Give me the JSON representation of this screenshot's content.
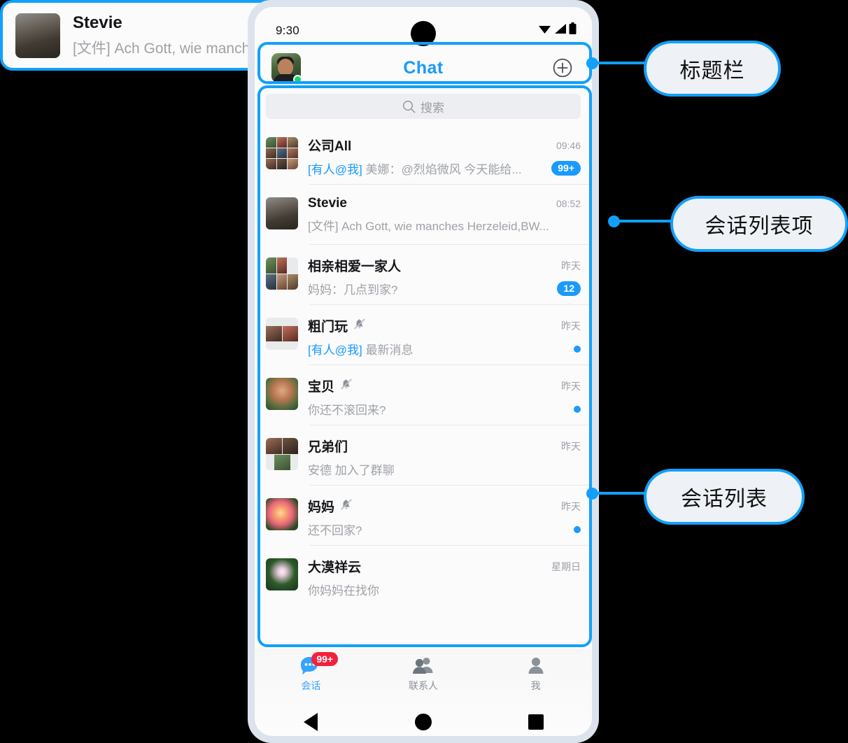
{
  "status_bar": {
    "time": "9:30",
    "wifi_icon": "wifi-icon",
    "signal_icon": "signal-icon",
    "battery_icon": "battery-icon"
  },
  "title_bar": {
    "title": "Chat",
    "add_label": "+",
    "avatar_name": "user-avatar",
    "online": true
  },
  "search": {
    "placeholder": "搜索",
    "icon": "search-icon"
  },
  "conversations": [
    {
      "name": "公司All",
      "time": "09:46",
      "mention": "[有人@我]",
      "message": "美娜：@烈焰微风 今天能给...",
      "badge": "99+",
      "muted": false,
      "avatar": "group-9-grid"
    },
    {
      "name": "Stevie",
      "time": "08:52",
      "mention": "",
      "message": "[文件] Ach Gott, wie manches Herzeleid,BW...",
      "badge": "",
      "muted": false,
      "avatar": "photo-portrait"
    },
    {
      "name": "相亲相爱一家人",
      "time": "昨天",
      "mention": "",
      "message": "妈妈：几点到家?",
      "badge": "12",
      "muted": false,
      "avatar": "group-5-grid"
    },
    {
      "name": "粗门玩",
      "time": "昨天",
      "mention": "[有人@我]",
      "message": "最新消息",
      "badge": "dot",
      "muted": true,
      "avatar": "group-2-grid"
    },
    {
      "name": "宝贝",
      "time": "昨天",
      "mention": "",
      "message": "你还不滚回来?",
      "badge": "dot",
      "muted": true,
      "avatar": "photo-woman"
    },
    {
      "name": "兄弟们",
      "time": "昨天",
      "mention": "",
      "message": "安德 加入了群聊",
      "badge": "",
      "muted": false,
      "avatar": "group-3-grid"
    },
    {
      "name": "妈妈",
      "time": "昨天",
      "mention": "",
      "message": "还不回家?",
      "badge": "dot",
      "muted": true,
      "avatar": "photo-rose"
    },
    {
      "name": "大漠祥云",
      "time": "星期日",
      "mention": "",
      "message": "你妈妈在找你",
      "badge": "",
      "muted": false,
      "avatar": "photo-lotus"
    }
  ],
  "tabs": [
    {
      "label": "会话",
      "icon": "chat-bubble-icon",
      "badge": "99+",
      "active": true
    },
    {
      "label": "联系人",
      "icon": "contacts-icon",
      "badge": "",
      "active": false
    },
    {
      "label": "我",
      "icon": "person-icon",
      "badge": "",
      "active": false
    }
  ],
  "system_nav": {
    "back": "nav-back-icon",
    "home": "nav-home-icon",
    "recent": "nav-recent-icon"
  },
  "annotations": [
    {
      "label": "标题栏",
      "target": "title-bar"
    },
    {
      "label": "会话列表项",
      "target": "conversation-list-item"
    },
    {
      "label": "会话列表",
      "target": "conversation-list"
    }
  ],
  "colors": {
    "accent": "#1a9afc",
    "highlight": "#11a0fb",
    "badge_red": "#f5203c",
    "online_green": "#18d663"
  }
}
